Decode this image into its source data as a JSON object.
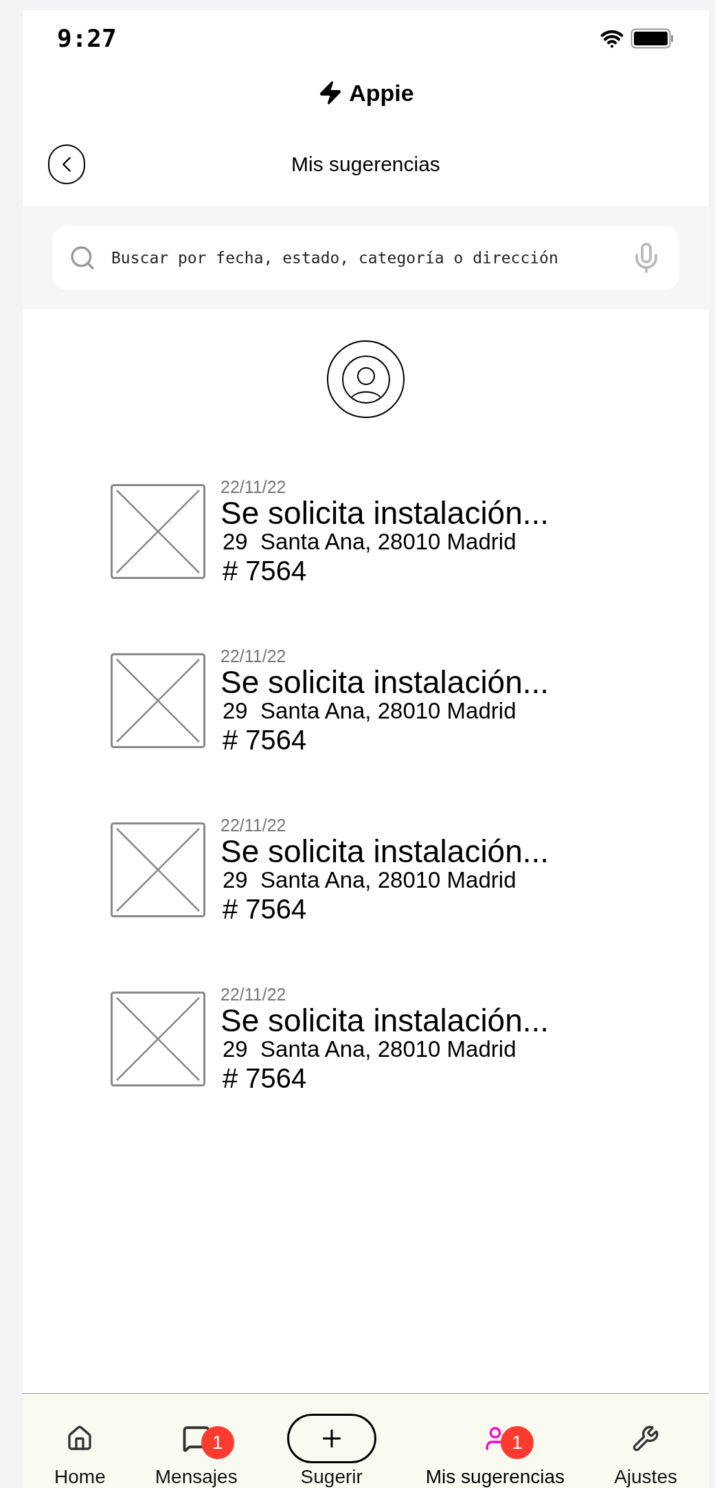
{
  "status_bar": {
    "time": "9:27"
  },
  "app": {
    "name": "Appie"
  },
  "header": {
    "title": "Mis sugerencias"
  },
  "search": {
    "placeholder": "Buscar por fecha, estado, categoría o dirección"
  },
  "suggestions": [
    {
      "date": "22/11/22",
      "title": "Se solicita instalación...",
      "address": "29  Santa Ana, 28010 Madrid",
      "number": "# 7564"
    },
    {
      "date": "22/11/22",
      "title": "Se solicita instalación...",
      "address": "29  Santa Ana, 28010 Madrid",
      "number": "# 7564"
    },
    {
      "date": "22/11/22",
      "title": "Se solicita instalación...",
      "address": "29  Santa Ana, 28010 Madrid",
      "number": "# 7564"
    },
    {
      "date": "22/11/22",
      "title": "Se solicita instalación...",
      "address": "29  Santa Ana, 28010 Madrid",
      "number": "# 7564"
    }
  ],
  "nav": [
    {
      "kind": "home",
      "label": "Home",
      "selected": false
    },
    {
      "kind": "messages",
      "label": "Mensajes",
      "selected": false,
      "badge": "1"
    },
    {
      "kind": "add",
      "label": "Sugerir",
      "selected": false
    },
    {
      "kind": "suggestions",
      "label": "Mis sugerencias",
      "selected": true,
      "badge": "1"
    },
    {
      "kind": "settings",
      "label": "Ajustes",
      "selected": false
    }
  ]
}
